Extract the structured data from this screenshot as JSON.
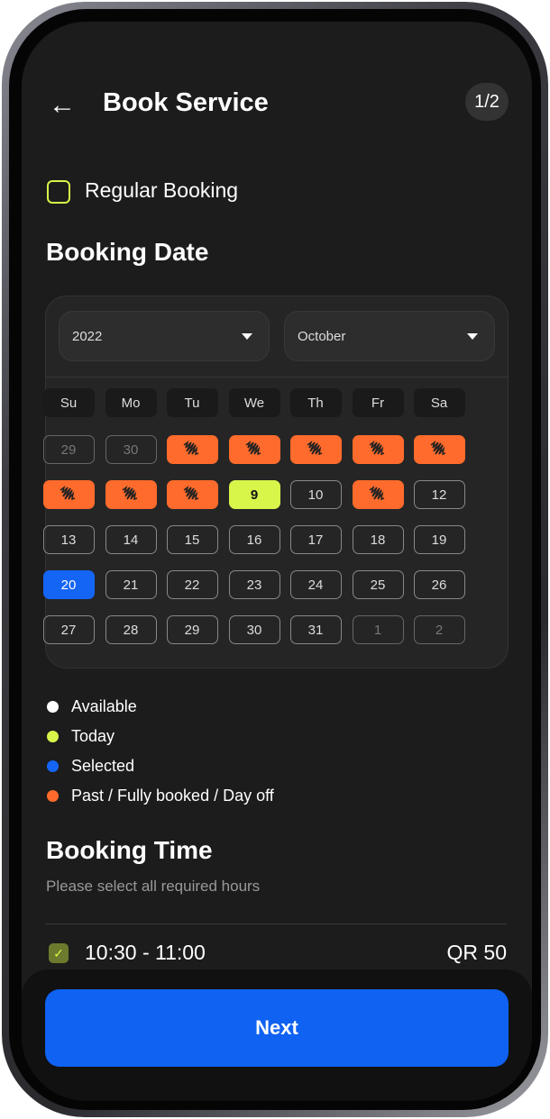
{
  "header": {
    "back_icon": "arrow-left-icon",
    "title": "Book Service",
    "step": "1/2"
  },
  "regular_booking": {
    "label": "Regular Booking",
    "checked": false
  },
  "booking_date": {
    "title": "Booking Date",
    "year": "2022",
    "month": "October",
    "weekdays": [
      "Su",
      "Mo",
      "Tu",
      "We",
      "Th",
      "Fr",
      "Sa"
    ],
    "weeks": [
      [
        {
          "d": "29",
          "s": "muted"
        },
        {
          "d": "30",
          "s": "muted"
        },
        {
          "d": "",
          "s": "booked"
        },
        {
          "d": "",
          "s": "booked"
        },
        {
          "d": "",
          "s": "booked"
        },
        {
          "d": "",
          "s": "booked"
        },
        {
          "d": "",
          "s": "booked"
        }
      ],
      [
        {
          "d": "",
          "s": "booked"
        },
        {
          "d": "",
          "s": "booked"
        },
        {
          "d": "",
          "s": "booked"
        },
        {
          "d": "9",
          "s": "today"
        },
        {
          "d": "10",
          "s": "available"
        },
        {
          "d": "",
          "s": "booked"
        },
        {
          "d": "12",
          "s": "available"
        }
      ],
      [
        {
          "d": "13",
          "s": "available"
        },
        {
          "d": "14",
          "s": "available"
        },
        {
          "d": "15",
          "s": "available"
        },
        {
          "d": "16",
          "s": "available"
        },
        {
          "d": "17",
          "s": "available"
        },
        {
          "d": "18",
          "s": "available"
        },
        {
          "d": "19",
          "s": "available"
        }
      ],
      [
        {
          "d": "20",
          "s": "selected"
        },
        {
          "d": "21",
          "s": "available"
        },
        {
          "d": "22",
          "s": "available"
        },
        {
          "d": "23",
          "s": "available"
        },
        {
          "d": "24",
          "s": "available"
        },
        {
          "d": "25",
          "s": "available"
        },
        {
          "d": "26",
          "s": "available"
        }
      ],
      [
        {
          "d": "27",
          "s": "available"
        },
        {
          "d": "28",
          "s": "available"
        },
        {
          "d": "29",
          "s": "available"
        },
        {
          "d": "30",
          "s": "available"
        },
        {
          "d": "31",
          "s": "available"
        },
        {
          "d": "1",
          "s": "muted"
        },
        {
          "d": "2",
          "s": "muted"
        }
      ]
    ]
  },
  "legend": [
    {
      "label": "Available",
      "color": "#ffffff"
    },
    {
      "label": "Today",
      "color": "#d8f54a"
    },
    {
      "label": "Selected",
      "color": "#1565f5"
    },
    {
      "label": "Past / Fully booked / Day off",
      "color": "#ff6b2c"
    }
  ],
  "booking_time": {
    "title": "Booking Time",
    "subtitle": "Please select all required hours",
    "slots": [
      {
        "time": "10:30 - 11:00",
        "price": "QR 50",
        "checked": true
      }
    ]
  },
  "next_label": "Next"
}
